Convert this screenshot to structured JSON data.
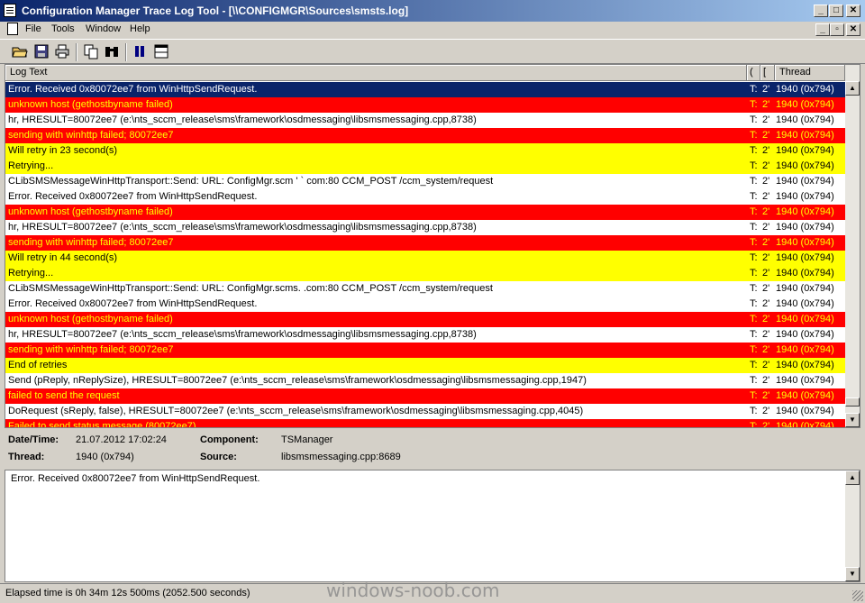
{
  "window": {
    "title": "Configuration Manager Trace Log Tool - [\\\\CONFIGMGR\\Sources\\smsts.log]"
  },
  "menu": [
    "File",
    "Tools",
    "Window",
    "Help"
  ],
  "columns": {
    "text": "Log Text",
    "a": "(",
    "b": "[",
    "thread": "Thread"
  },
  "colors": {
    "selected": "#0a246a",
    "error": "#ff0000",
    "warning": "#ffff00",
    "normal": "#ffffff"
  },
  "rows": [
    {
      "text": "Error. Received 0x80072ee7 from WinHttpSendRequest.",
      "a": "T:",
      "b": "2'",
      "thread": "1940 (0x794)",
      "level": "selected"
    },
    {
      "text": "unknown host (gethostbyname failed)",
      "a": "T:",
      "b": "2'",
      "thread": "1940 (0x794)",
      "level": "error"
    },
    {
      "text": "hr, HRESULT=80072ee7 (e:\\nts_sccm_release\\sms\\framework\\osdmessaging\\libsmsmessaging.cpp,8738)",
      "a": "T:",
      "b": "2'",
      "thread": "1940 (0x794)",
      "level": "normal"
    },
    {
      "text": "sending with winhttp failed; 80072ee7",
      "a": "T:",
      "b": "2'",
      "thread": "1940 (0x794)",
      "level": "error"
    },
    {
      "text": "Will retry in 23 second(s)",
      "a": "T:",
      "b": "2'",
      "thread": "1940 (0x794)",
      "level": "warning"
    },
    {
      "text": "Retrying...",
      "a": "T:",
      "b": "2'",
      "thread": "1940 (0x794)",
      "level": "warning"
    },
    {
      "text": "CLibSMSMessageWinHttpTransport::Send: URL: ConfigMgr.scm          ' ` com:80  CCM_POST /ccm_system/request",
      "a": "T:",
      "b": "2'",
      "thread": "1940 (0x794)",
      "level": "normal"
    },
    {
      "text": "Error. Received 0x80072ee7 from WinHttpSendRequest.",
      "a": "T:",
      "b": "2'",
      "thread": "1940 (0x794)",
      "level": "normal"
    },
    {
      "text": "unknown host (gethostbyname failed)",
      "a": "T:",
      "b": "2'",
      "thread": "1940 (0x794)",
      "level": "error"
    },
    {
      "text": "hr, HRESULT=80072ee7 (e:\\nts_sccm_release\\sms\\framework\\osdmessaging\\libsmsmessaging.cpp,8738)",
      "a": "T:",
      "b": "2'",
      "thread": "1940 (0x794)",
      "level": "normal"
    },
    {
      "text": "sending with winhttp failed; 80072ee7",
      "a": "T:",
      "b": "2'",
      "thread": "1940 (0x794)",
      "level": "error"
    },
    {
      "text": "Will retry in 44 second(s)",
      "a": "T:",
      "b": "2'",
      "thread": "1940 (0x794)",
      "level": "warning"
    },
    {
      "text": "Retrying...",
      "a": "T:",
      "b": "2'",
      "thread": "1940 (0x794)",
      "level": "warning"
    },
    {
      "text": "CLibSMSMessageWinHttpTransport::Send: URL: ConfigMgr.scms.           .com:80  CCM_POST /ccm_system/request",
      "a": "T:",
      "b": "2'",
      "thread": "1940 (0x794)",
      "level": "normal"
    },
    {
      "text": "Error. Received 0x80072ee7 from WinHttpSendRequest.",
      "a": "T:",
      "b": "2'",
      "thread": "1940 (0x794)",
      "level": "normal"
    },
    {
      "text": "unknown host (gethostbyname failed)",
      "a": "T:",
      "b": "2'",
      "thread": "1940 (0x794)",
      "level": "error"
    },
    {
      "text": "hr, HRESULT=80072ee7 (e:\\nts_sccm_release\\sms\\framework\\osdmessaging\\libsmsmessaging.cpp,8738)",
      "a": "T:",
      "b": "2'",
      "thread": "1940 (0x794)",
      "level": "normal"
    },
    {
      "text": "sending with winhttp failed; 80072ee7",
      "a": "T:",
      "b": "2'",
      "thread": "1940 (0x794)",
      "level": "error"
    },
    {
      "text": "End of retries",
      "a": "T:",
      "b": "2'",
      "thread": "1940 (0x794)",
      "level": "warning"
    },
    {
      "text": "Send (pReply, nReplySize), HRESULT=80072ee7 (e:\\nts_sccm_release\\sms\\framework\\osdmessaging\\libsmsmessaging.cpp,1947)",
      "a": "T:",
      "b": "2'",
      "thread": "1940 (0x794)",
      "level": "normal"
    },
    {
      "text": "failed to send the request",
      "a": "T:",
      "b": "2'",
      "thread": "1940 (0x794)",
      "level": "error"
    },
    {
      "text": "DoRequest (sReply, false), HRESULT=80072ee7 (e:\\nts_sccm_release\\sms\\framework\\osdmessaging\\libsmsmessaging.cpp,4045)",
      "a": "T:",
      "b": "2'",
      "thread": "1940 (0x794)",
      "level": "normal"
    },
    {
      "text": "Failed to send status message (80072ee7)",
      "a": "T:",
      "b": "2'",
      "thread": "1940 (0x794)",
      "level": "error"
    }
  ],
  "details": {
    "datetime_label": "Date/Time:",
    "datetime": "21.07.2012 17:02:24",
    "component_label": "Component:",
    "component": "TSManager",
    "thread_label": "Thread:",
    "thread": "1940 (0x794)",
    "source_label": "Source:",
    "source": "libsmsmessaging.cpp:8689"
  },
  "message": "Error. Received 0x80072ee7 from WinHttpSendRequest.",
  "status": "Elapsed time is 0h 34m 12s 500ms (2052.500 seconds)",
  "watermark": "windows-noob.com"
}
